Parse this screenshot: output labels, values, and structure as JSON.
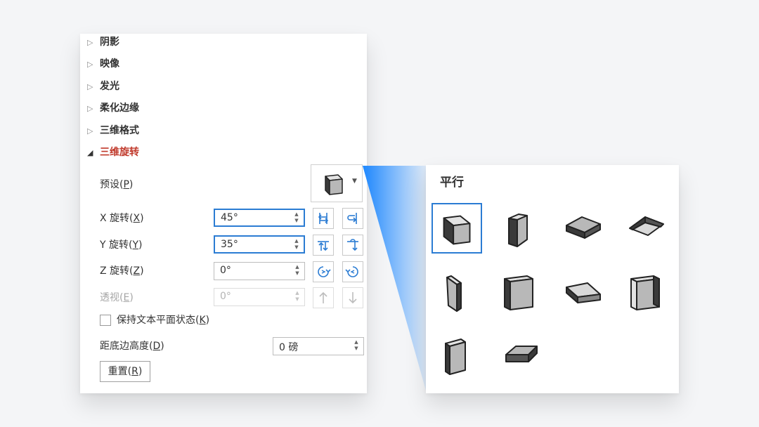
{
  "sections": [
    {
      "label": "阴影",
      "expanded": false
    },
    {
      "label": "映像",
      "expanded": false
    },
    {
      "label": "发光",
      "expanded": false
    },
    {
      "label": "柔化边缘",
      "expanded": false
    },
    {
      "label": "三维格式",
      "expanded": false
    },
    {
      "label": "三维旋转",
      "expanded": true
    }
  ],
  "rotation": {
    "preset_label": "预设(",
    "preset_key": "P",
    "x_label": "X 旋转(",
    "x_key": "X",
    "x_value": "45°",
    "y_label": "Y 旋转(",
    "y_key": "Y",
    "y_value": "35°",
    "z_label": "Z 旋转(",
    "z_key": "Z",
    "z_value": "0°",
    "perspective_label": "透视(",
    "perspective_key": "E",
    "perspective_value": "0°",
    "keep_flat_label": "保持文本平面状态(",
    "keep_flat_key": "K",
    "keep_flat_checked": false,
    "distance_label": "距底边高度(",
    "distance_key": "D",
    "distance_value": "0 磅",
    "reset_label": "重置(",
    "reset_key": "R",
    "close_paren": ")"
  },
  "icons": {
    "expand": "triangle-right-icon",
    "collapse": "triangle-down-icon",
    "dropdown": "chevron-down-icon",
    "spin": "spin-up-down-icon"
  },
  "gallery": {
    "title": "平行",
    "selected_index": 0,
    "presets": [
      "isometric-left-down",
      "isometric-right-up",
      "isometric-top-up",
      "isometric-top-down",
      "off-axis-1-left",
      "off-axis-1-right",
      "off-axis-1-top",
      "off-axis-2-left",
      "off-axis-2-right",
      "off-axis-2-top"
    ]
  },
  "colors": {
    "accent": "#2b7cd3",
    "active_section": "#c0392b",
    "beam": "#1e88ff"
  }
}
